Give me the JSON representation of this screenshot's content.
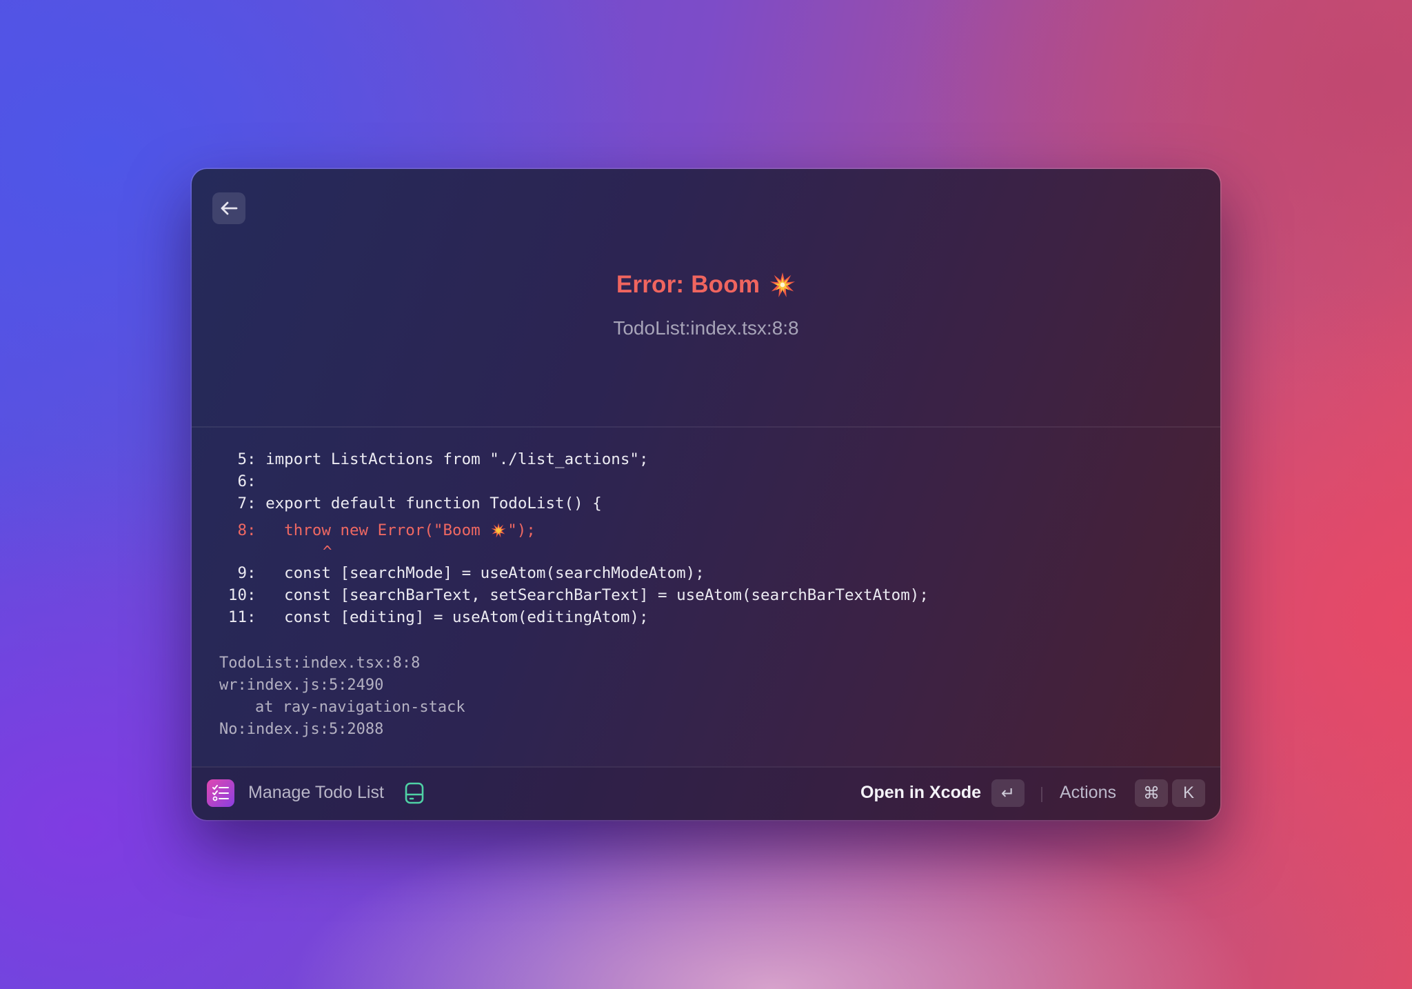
{
  "error": {
    "title": "Error: Boom",
    "location": "TodoList:index.tsx:8:8"
  },
  "code_lines": [
    {
      "num": "5",
      "text": "import ListActions from \"./list_actions\";"
    },
    {
      "num": "6",
      "text": ""
    },
    {
      "num": "7",
      "text": "export default function TodoList() {"
    },
    {
      "num": "8",
      "text_before": "  throw new Error(\"Boom ",
      "text_after": "\");"
    },
    {
      "num": "9",
      "text": "  const [searchMode] = useAtom(searchModeAtom);"
    },
    {
      "num": "10",
      "text": "  const [searchBarText, setSearchBarText] = useAtom(searchBarTextAtom);"
    },
    {
      "num": "11",
      "text": "  const [editing] = useAtom(editingAtom);"
    }
  ],
  "caret": "^",
  "stack_trace": [
    "TodoList:index.tsx:8:8",
    "wr:index.js:5:2490",
    "at ray-navigation-stack",
    "No:index.js:5:2088"
  ],
  "footer": {
    "extension_name": "Manage Todo List",
    "extension_icon": "checklist-icon",
    "dev_icon": "development-drive-icon",
    "primary_action": "Open in Xcode",
    "primary_shortcut": "↵",
    "actions_label": "Actions",
    "actions_shortcut_mod": "⌘",
    "actions_shortcut_key": "K"
  },
  "colors": {
    "error": "#f0655f",
    "accent_icon": "#e048b0",
    "dev_icon": "#4fd1a5"
  }
}
